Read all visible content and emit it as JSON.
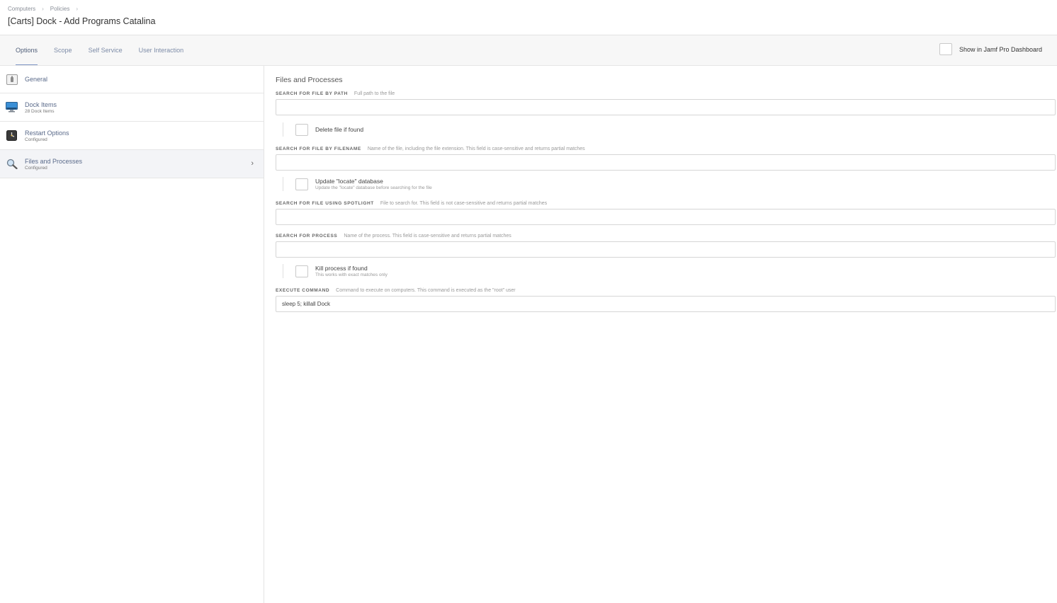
{
  "breadcrumb": {
    "items": [
      "Computers",
      "Policies"
    ],
    "separator": "›"
  },
  "page_title": "[Carts] Dock - Add Programs Catalina",
  "tabs": [
    {
      "label": "Options",
      "active": true
    },
    {
      "label": "Scope",
      "active": false
    },
    {
      "label": "Self Service",
      "active": false
    },
    {
      "label": "User Interaction",
      "active": false
    }
  ],
  "dashboard": {
    "label": "Show in Jamf Pro Dashboard",
    "checked": false
  },
  "sidebar": {
    "items": [
      {
        "label": "General",
        "sub": "",
        "icon": "general-icon"
      },
      {
        "label": "Dock Items",
        "sub": "28 Dock Items",
        "icon": "monitor-icon"
      },
      {
        "label": "Restart Options",
        "sub": "Configured",
        "icon": "restart-icon"
      },
      {
        "label": "Files and Processes",
        "sub": "Configured",
        "icon": "magnifier-icon",
        "active": true
      }
    ],
    "chevron": "›"
  },
  "content": {
    "title": "Files and Processes",
    "path": {
      "label": "SEARCH FOR FILE BY PATH",
      "hint": "Full path to the file",
      "value": ""
    },
    "delete_opt": {
      "label": "Delete file if found",
      "sub": "",
      "checked": false
    },
    "filename": {
      "label": "SEARCH FOR FILE BY FILENAME",
      "hint": "Name of the file, including the file extension. This field is case-sensitive and returns partial matches",
      "value": ""
    },
    "locate_opt": {
      "label": "Update \"locate\" database",
      "sub": "Update the \"locate\" database before searching for the file",
      "checked": false
    },
    "spotlight": {
      "label": "SEARCH FOR FILE USING SPOTLIGHT",
      "hint": "File to search for. This field is not case-sensitive and returns partial matches",
      "value": ""
    },
    "process": {
      "label": "SEARCH FOR PROCESS",
      "hint": "Name of the process. This field is case-sensitive and returns partial matches",
      "value": ""
    },
    "kill_opt": {
      "label": "Kill process if found",
      "sub": "This works with exact matches only",
      "checked": false
    },
    "command": {
      "label": "EXECUTE COMMAND",
      "hint": "Command to execute on computers. This command is executed as the \"root\" user",
      "value": "sleep 5; killall Dock"
    }
  },
  "colors": {
    "link": "#5a6a8a",
    "tab_underline": "#7f95c4",
    "active_row": "#f3f4f7"
  }
}
